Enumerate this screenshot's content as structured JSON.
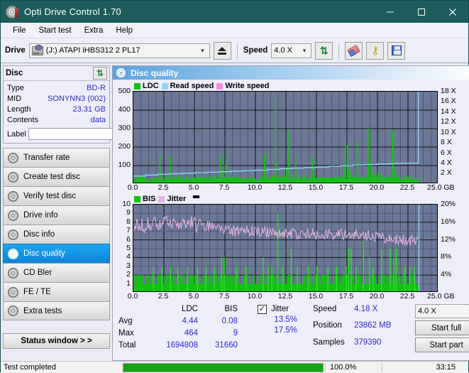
{
  "window": {
    "title": "Opti Drive Control 1.70",
    "icon": "disc-icon",
    "minimize": "–",
    "maximize": "□",
    "close": "✕"
  },
  "menu": [
    "File",
    "Start test",
    "Extra",
    "Help"
  ],
  "toolbar": {
    "drive_label": "Drive",
    "drive_value": "(J:)  ATAPI iHBS312  2 PL17",
    "eject_title": "Eject",
    "speed_label": "Speed",
    "speed_value": "4.0 X",
    "refresh_title": "Refresh",
    "erase_title": "Erase",
    "key_title": "Key",
    "save_title": "Save"
  },
  "sidebar": {
    "disc_panel_title": "Disc",
    "refresh_icon": "refresh-icon",
    "rows": [
      {
        "key": "Type",
        "value": "BD-R"
      },
      {
        "key": "MID",
        "value": "SONYNN3 (002)"
      },
      {
        "key": "Length",
        "value": "23.31 GB"
      },
      {
        "key": "Contents",
        "value": "data"
      }
    ],
    "label_key": "Label",
    "label_value": "",
    "nav": [
      {
        "label": "Transfer rate",
        "active": false
      },
      {
        "label": "Create test disc",
        "active": false
      },
      {
        "label": "Verify test disc",
        "active": false
      },
      {
        "label": "Drive info",
        "active": false
      },
      {
        "label": "Disc info",
        "active": false
      },
      {
        "label": "Disc quality",
        "active": true
      },
      {
        "label": "CD Bler",
        "active": false
      },
      {
        "label": "FE / TE",
        "active": false
      },
      {
        "label": "Extra tests",
        "active": false
      }
    ],
    "status_window": "Status window > >"
  },
  "main": {
    "panel_title": "Disc quality"
  },
  "stats": {
    "col_ldc": "LDC",
    "col_bis": "BIS",
    "row_avg": "Avg",
    "row_max": "Max",
    "row_total": "Total",
    "ldc_avg": "4.44",
    "ldc_max": "464",
    "ldc_total": "1694808",
    "bis_avg": "0.08",
    "bis_max": "9",
    "bis_total": "31660",
    "jitter_label": "Jitter",
    "jitter_checked": "✓",
    "jitter_avg": "13.5%",
    "jitter_max": "17.5%",
    "speed_label": "Speed",
    "speed_value": "4.18 X",
    "position_label": "Position",
    "position_value": "23862 MB",
    "samples_label": "Samples",
    "samples_value": "379390",
    "speed_select": "4.0 X",
    "start_full": "Start full",
    "start_part": "Start part"
  },
  "statusbar": {
    "text": "Test completed",
    "percent": "100.0%",
    "progress": 100,
    "time": "33:15"
  },
  "colors": {
    "ldc_green": "#12c212",
    "read_speed": "#8fd8f8",
    "write_speed": "#f888e0",
    "bis_green": "#12c212",
    "jitter_pink": "#e8b4e0",
    "plot_bg": "#6b7895",
    "accent": "#2b2bd0"
  },
  "chart_data": [
    {
      "type": "bar",
      "id": "disc-quality-ldc",
      "title": "",
      "legend": [
        {
          "name": "LDC",
          "color": "#12c212"
        },
        {
          "name": "Read speed",
          "color": "#8fd8f8"
        },
        {
          "name": "Write speed",
          "color": "#f888e0"
        }
      ],
      "legend_position": "top-left",
      "grid": true,
      "xlabel": "GB",
      "x_ticks": [
        "0.0",
        "2.5",
        "5.0",
        "7.5",
        "10.0",
        "12.5",
        "15.0",
        "17.5",
        "20.0",
        "22.5",
        "25.0 GB"
      ],
      "xlim": [
        0,
        25
      ],
      "ylabel": "",
      "y_ticks": [
        "100",
        "200",
        "300",
        "400",
        "500"
      ],
      "ylim": [
        0,
        500
      ],
      "y2_ticks": [
        "2 X",
        "4 X",
        "6 X",
        "8 X",
        "10 X",
        "12 X",
        "14 X",
        "16 X",
        "18 X"
      ],
      "y2lim": [
        0,
        18
      ],
      "series": [
        {
          "name": "LDC",
          "color": "#12c212",
          "type": "bar",
          "x": [
            0.1,
            0.3,
            0.5,
            0.7,
            0.9,
            1.1,
            1.3,
            1.5,
            1.7,
            1.9,
            2.1,
            2.25,
            2.4,
            2.6,
            2.8,
            3.0,
            3.2,
            3.4,
            3.55,
            3.7,
            3.9,
            4.1,
            4.3,
            4.5,
            4.7,
            4.9,
            5.1,
            5.3,
            5.5,
            5.7,
            5.9,
            6.1,
            6.3,
            6.5,
            6.7,
            6.9,
            7.1,
            7.2,
            7.35,
            7.5,
            7.65,
            7.8,
            7.95,
            8.1,
            8.3,
            8.5,
            8.7,
            8.9,
            9.1,
            9.3,
            9.5,
            9.7,
            9.9,
            10.1,
            10.3,
            10.5,
            10.7,
            10.85,
            11.0,
            11.2,
            11.4,
            11.6,
            11.75,
            11.9,
            12.1,
            12.3,
            12.5,
            12.7,
            12.9,
            13.1,
            13.25,
            13.4,
            13.6,
            13.8,
            14.0,
            14.2,
            14.4,
            14.6,
            14.8,
            15.0,
            15.2,
            15.4,
            15.6,
            15.8,
            16.0,
            16.2,
            16.4,
            16.6,
            16.8,
            17.0,
            17.2,
            17.35,
            17.5,
            17.6,
            17.75,
            17.9,
            18.1,
            18.3,
            18.5,
            18.65,
            18.8,
            19.0,
            19.2,
            19.4,
            19.55,
            19.7,
            19.85,
            20.0,
            20.2,
            20.4,
            20.6,
            20.8,
            21.0,
            21.2,
            21.35,
            21.5,
            21.7,
            21.9,
            22.1,
            22.3,
            22.5,
            22.7,
            22.9,
            23.1,
            23.3
          ],
          "values": [
            40,
            30,
            25,
            20,
            22,
            18,
            20,
            25,
            30,
            40,
            160,
            60,
            35,
            25,
            30,
            150,
            40,
            25,
            30,
            20,
            25,
            30,
            40,
            25,
            20,
            25,
            30,
            35,
            25,
            30,
            45,
            40,
            25,
            30,
            40,
            25,
            155,
            60,
            30,
            105,
            160,
            50,
            35,
            30,
            40,
            35,
            30,
            25,
            30,
            35,
            30,
            40,
            30,
            25,
            30,
            45,
            160,
            40,
            30,
            35,
            45,
            460,
            120,
            60,
            45,
            40,
            90,
            285,
            70,
            50,
            155,
            60,
            40,
            35,
            45,
            40,
            35,
            145,
            50,
            35,
            40,
            30,
            35,
            30,
            25,
            30,
            40,
            35,
            30,
            45,
            110,
            220,
            215,
            85,
            60,
            40,
            50,
            235,
            60,
            45,
            35,
            50,
            300,
            120,
            60,
            45,
            55,
            70,
            50,
            40,
            35,
            30,
            40,
            290,
            80,
            50,
            40,
            35,
            45,
            40,
            35
          ]
        },
        {
          "name": "Read speed",
          "color": "#8fd8f8",
          "type": "line",
          "x": [
            0.0,
            1.0,
            2.0,
            3.0,
            4.0,
            5.0,
            6.0,
            7.0,
            8.0,
            9.0,
            10.0,
            11.0,
            12.0,
            13.0,
            14.0,
            15.0,
            16.0,
            17.0,
            18.0,
            19.0,
            20.0,
            21.0,
            22.0,
            23.3,
            23.35
          ],
          "values_x2": [
            1.55,
            1.75,
            1.9,
            2.0,
            2.1,
            2.2,
            2.3,
            2.4,
            2.5,
            2.6,
            2.7,
            2.85,
            3.0,
            3.1,
            3.2,
            3.3,
            3.45,
            3.55,
            3.7,
            3.8,
            3.9,
            4.0,
            4.05,
            4.1,
            18.0
          ],
          "note": "blue read-speed curve rises from ~1.6X to ~4.1X then vertical jump at 23.35 GB"
        },
        {
          "name": "Write speed",
          "color": "#f888e0",
          "type": "line",
          "x": [],
          "values": []
        }
      ]
    },
    {
      "type": "bar",
      "id": "disc-quality-bis",
      "title": "",
      "legend": [
        {
          "name": "BIS",
          "color": "#12c212"
        },
        {
          "name": "Jitter",
          "color": "#e8b4e0"
        }
      ],
      "legend_position": "top-left",
      "grid": true,
      "xlabel": "GB",
      "x_ticks": [
        "0.0",
        "2.5",
        "5.0",
        "7.5",
        "10.0",
        "12.5",
        "15.0",
        "17.5",
        "20.0",
        "22.5",
        "25.0 GB"
      ],
      "xlim": [
        0,
        25
      ],
      "y_ticks": [
        "1",
        "2",
        "3",
        "4",
        "5",
        "6",
        "7",
        "8",
        "9",
        "10"
      ],
      "ylim": [
        0,
        10
      ],
      "y2_ticks": [
        "4%",
        "8%",
        "12%",
        "16%",
        "20%"
      ],
      "y2lim": [
        0,
        20
      ],
      "series": [
        {
          "name": "BIS",
          "color": "#12c212",
          "type": "bar",
          "baseline": 2,
          "note": "dense bars at 1-2 across 0-23.3 GB, occasional spikes to 3-5, one to 9 at 11.8 GB",
          "spikes_x": [
            1.6,
            2.3,
            3.0,
            3.6,
            4.4,
            5.2,
            5.9,
            6.6,
            7.2,
            7.4,
            8.4,
            9.2,
            10.6,
            11.0,
            11.3,
            11.8,
            12.2,
            12.9,
            13.4,
            14.3,
            15.0,
            15.9,
            16.6,
            17.4,
            17.6,
            17.8,
            18.2,
            18.8,
            19.3,
            19.6,
            20.3,
            21.0,
            21.3,
            21.5,
            22.2,
            22.6,
            23.0
          ],
          "spikes_y": [
            3,
            3,
            3,
            3,
            3,
            3,
            3,
            3,
            4,
            4,
            3,
            3,
            4,
            3,
            3,
            9,
            3,
            5,
            3,
            3,
            3,
            3,
            3,
            3,
            5,
            5,
            3,
            6,
            4,
            3,
            5,
            5,
            4,
            5,
            3,
            3,
            3
          ]
        },
        {
          "name": "Jitter",
          "color": "#e8b4e0",
          "type": "line",
          "note": "noisy band, starts ~7.5 (15%), peaks ~8.5 around 4-6 GB, declines to ~6 (12%) by 22.5 GB",
          "x": [
            0,
            2,
            4,
            6,
            8,
            10,
            12,
            14,
            16,
            18,
            20,
            22,
            23.3
          ],
          "values": [
            7.5,
            7.8,
            8.0,
            7.6,
            7.0,
            7.0,
            6.8,
            6.7,
            6.7,
            6.6,
            6.4,
            6.0,
            5.8
          ]
        }
      ]
    }
  ]
}
